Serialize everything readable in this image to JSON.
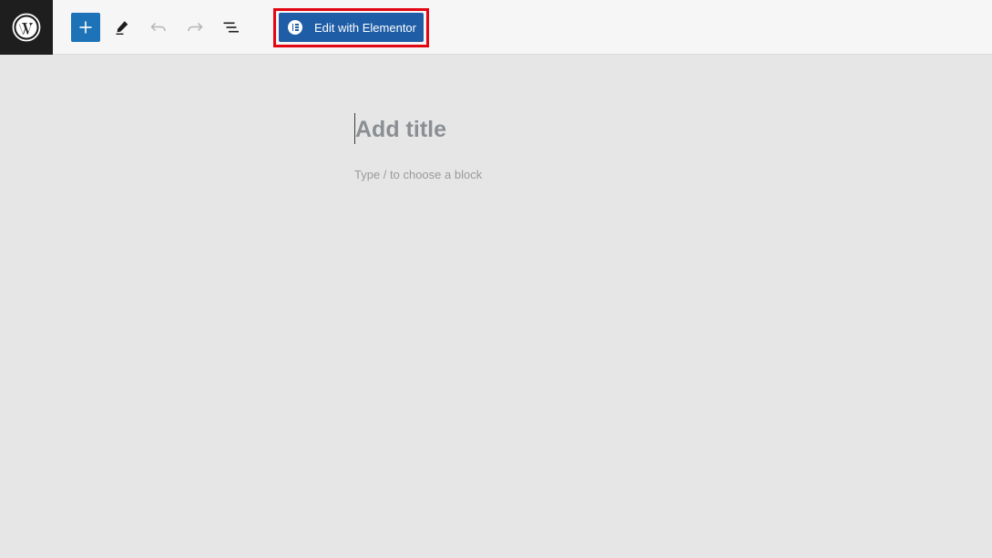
{
  "toolbar": {
    "logo_icon": "wordpress-icon",
    "inserter_icon": "plus-icon",
    "tools_icon": "pencil-icon",
    "undo_icon": "undo-icon",
    "redo_icon": "redo-icon",
    "list_view_icon": "list-view-icon",
    "elementor_button_label": "Edit with Elementor",
    "elementor_icon": "elementor-icon",
    "highlight_color": "#e30613",
    "elementor_color": "#1f5ea6",
    "inserter_color": "#1e73b8"
  },
  "editor": {
    "title_placeholder": "Add title",
    "block_placeholder": "Type / to choose a block"
  }
}
